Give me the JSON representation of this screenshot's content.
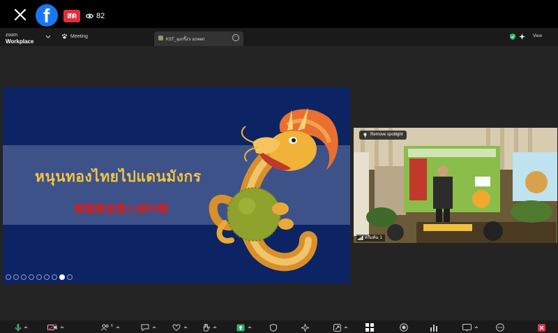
{
  "facebook": {
    "close_icon": "close-icon",
    "logo_icon": "facebook-logo",
    "live_label": "สด",
    "viewer_count": "82",
    "viewer_icon": "eye-icon",
    "brand_color": "#1877f2",
    "live_color": "#e02f3c"
  },
  "zoom": {
    "logo_line1": "zoom",
    "logo_line2": "Workplace",
    "meeting_label": "Meeting",
    "share_tab_label": "KST_ลุงกริ๊ง's screen",
    "view_label": "View"
  },
  "slide": {
    "title": "หนุนทองไทยไปแดนมังกร",
    "subtitle": "泰國黃金蜜入侵中國",
    "title_color": "#f5c542",
    "subtitle_color": "#d81c1c",
    "background": "#0c2364",
    "band_color": "#3d5289"
  },
  "video": {
    "remove_spotlight_label": "Remove spotlight",
    "participant_name": "ครีมค้น 1"
  },
  "toolbar": {
    "participants_count": "6",
    "icons": [
      "microphone-icon",
      "video-icon",
      "participants-icon",
      "chat-icon",
      "reactions-icon",
      "raise-hand-icon",
      "share-icon",
      "security-icon",
      "ai-companion-icon",
      "breakout-icon",
      "apps-icon",
      "record-icon",
      "stats-icon",
      "whiteboard-icon",
      "more-icon",
      "leave-icon"
    ]
  }
}
